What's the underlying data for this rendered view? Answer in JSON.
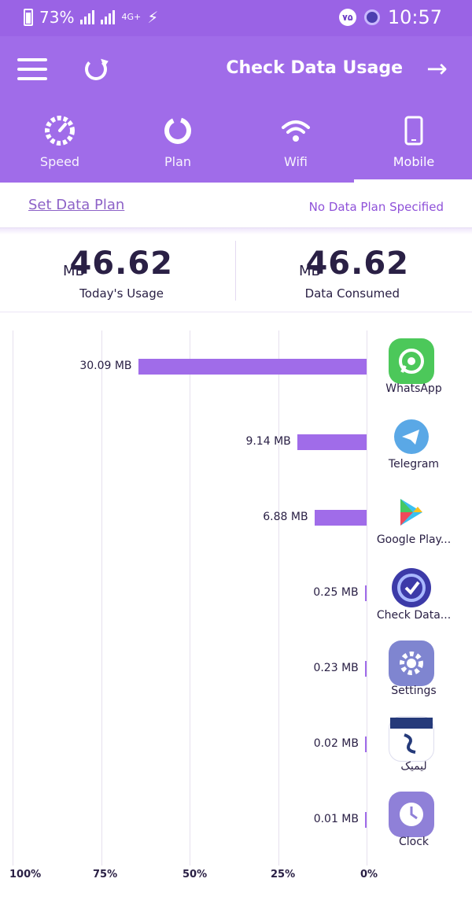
{
  "status_bar": {
    "battery": "73%",
    "network": "4G+",
    "badge": "۷۵",
    "time": "10:57"
  },
  "header": {
    "title": "Check Data Usage"
  },
  "tabs": [
    {
      "label": "Speed"
    },
    {
      "label": "Plan"
    },
    {
      "label": "Wifi"
    },
    {
      "label": "Mobile"
    }
  ],
  "plan": {
    "set_label": "Set Data Plan",
    "status": "No Data Plan Specified"
  },
  "stats": {
    "today": {
      "value": "46.62",
      "unit": "MB",
      "caption": "Today's Usage"
    },
    "consumed": {
      "value": "46.62",
      "unit": "MB",
      "caption": "Data Consumed"
    }
  },
  "chart_data": {
    "type": "bar",
    "orientation": "horizontal",
    "categories": [
      "WhatsApp",
      "Telegram",
      "Google Play...",
      "Check Data...",
      "Settings",
      "لیمیک",
      "Clock"
    ],
    "values": [
      30.09,
      9.14,
      6.88,
      0.25,
      0.23,
      0.02,
      0.01
    ],
    "value_labels": [
      "30.09 MB",
      "9.14 MB",
      "6.88 MB",
      "0.25 MB",
      "0.23 MB",
      "0.02 MB",
      "0.01 MB"
    ],
    "x_ticks": [
      "0%",
      "25%",
      "50%",
      "75%",
      "100%"
    ],
    "xlim": [
      0,
      46.62
    ],
    "grid": true
  },
  "app_icons": [
    "whatsapp-icon",
    "telegram-icon",
    "google-play-icon",
    "check-data-icon",
    "settings-icon",
    "roya-icon",
    "clock-icon"
  ],
  "colors": {
    "accent": "#a06ce9",
    "status_bar": "#9a63e5",
    "text": "#2a2045"
  }
}
